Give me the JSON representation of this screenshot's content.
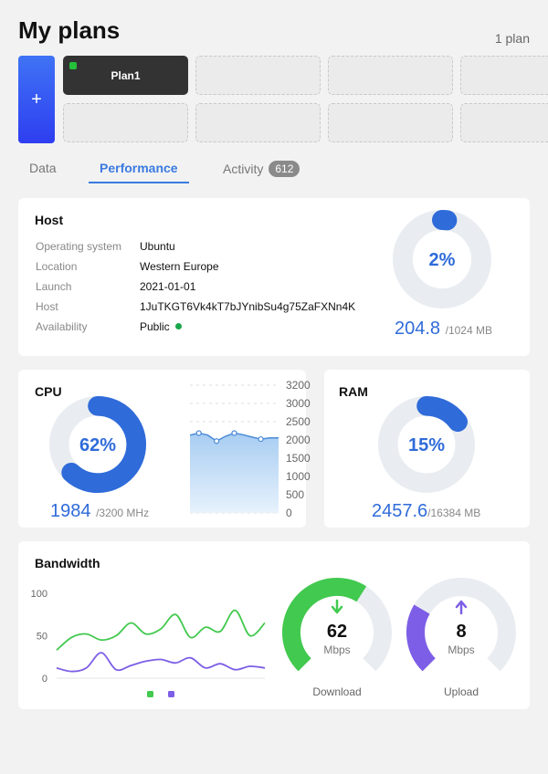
{
  "header": {
    "title": "My plans",
    "plan_count": "1 plan",
    "add_label": "+"
  },
  "plans": [
    {
      "name": "Plan1",
      "status_color": "#23c23a"
    }
  ],
  "tabs": [
    {
      "label": "Data"
    },
    {
      "label": "Performance",
      "active": true
    },
    {
      "label": "Activity",
      "badge": "612"
    }
  ],
  "host": {
    "title": "Host",
    "rows": [
      {
        "label": "Operating system",
        "value": "Ubuntu"
      },
      {
        "label": "Location",
        "value": "Western Europe"
      },
      {
        "label": "Launch",
        "value": "2021-01-01"
      },
      {
        "label": "Host",
        "value": "1JuTKGT6Vk4kT7bJYnibSu4g75ZaFXNn4K"
      },
      {
        "label": "Availability",
        "value": "Public"
      }
    ],
    "usage_pct": 2,
    "usage_pct_label": "2%",
    "used": "204.8",
    "total": "/1024 MB"
  },
  "cpu": {
    "title": "CPU",
    "pct": 62,
    "pct_label": "62%",
    "used": "1984",
    "total": "/3200 MHz",
    "axis_ticks": [
      "3200",
      "3000",
      "2500",
      "2000",
      "1500",
      "1000",
      "500",
      "0"
    ]
  },
  "ram": {
    "title": "RAM",
    "pct": 15,
    "pct_label": "15%",
    "used": "2457.6",
    "total": "/16384 MB"
  },
  "bandwidth": {
    "title": "Bandwidth",
    "y_ticks": [
      "100",
      "50",
      "0"
    ],
    "download": {
      "value": "62",
      "unit": "Mbps",
      "label": "Download",
      "color": "#42c94f",
      "pct": 0.62
    },
    "upload": {
      "value": "8",
      "unit": "Mbps",
      "label": "Upload",
      "color": "#7d5ee6",
      "pct": 0.28
    }
  },
  "colors": {
    "accent": "#2f6bd9",
    "ring_track": "#e9edf1",
    "download": "#42c94f",
    "upload": "#7d5ee6"
  },
  "chart_data": [
    {
      "type": "area",
      "chart": "cpu-history",
      "y_ticks": [
        3200,
        3000,
        2500,
        2000,
        1500,
        1000,
        500,
        0
      ],
      "ylim": [
        0,
        3200
      ],
      "series": [
        {
          "values": [
            1950,
            2000,
            1950,
            1800,
            1920,
            2000,
            1960,
            1900,
            1850,
            1880,
            1880
          ]
        }
      ],
      "markers_at": [
        1,
        3,
        5,
        8
      ]
    },
    {
      "type": "line",
      "chart": "bandwidth-history",
      "y_ticks": [
        100,
        50,
        0
      ],
      "ylim": [
        0,
        100
      ],
      "series": [
        {
          "color": "#42c94f",
          "values": [
            33,
            48,
            52,
            45,
            50,
            65,
            52,
            58,
            75,
            48,
            60,
            55,
            80,
            50,
            65
          ]
        },
        {
          "color": "#7d5ee6",
          "values": [
            12,
            8,
            12,
            30,
            10,
            15,
            20,
            22,
            18,
            24,
            12,
            17,
            10,
            14,
            12
          ]
        }
      ]
    }
  ]
}
